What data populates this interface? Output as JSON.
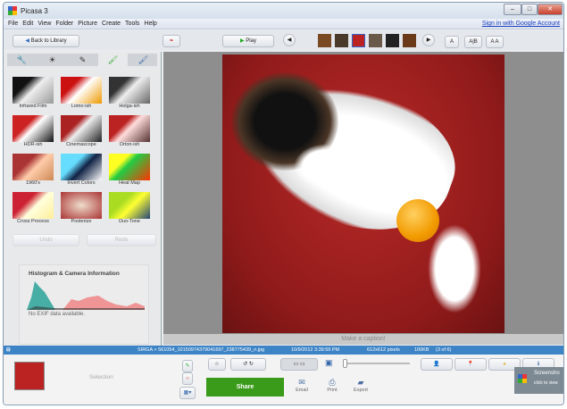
{
  "window": {
    "title": "Picasa 3",
    "controls": [
      "‒",
      "□",
      "✕"
    ]
  },
  "menu": {
    "items": [
      "File",
      "Edit",
      "View",
      "Folder",
      "Picture",
      "Create",
      "Tools",
      "Help"
    ],
    "sign_in": "Sign in with Google Account"
  },
  "toolbar": {
    "back": "Back to Library",
    "play": "Play",
    "layout_buttons": [
      "A",
      "A|B",
      "A A"
    ]
  },
  "left_tabs": [
    "🔧",
    "☀",
    "✎",
    "🖌",
    "🖌"
  ],
  "effects": [
    {
      "label": "Infrared Film",
      "bg": "linear-gradient(135deg,#111 30%,#eee 50%,#999)"
    },
    {
      "label": "Lomo-ish",
      "bg": "linear-gradient(135deg,#c11 30%,#fff 50%,#e90)"
    },
    {
      "label": "Holga-ish",
      "bg": "linear-gradient(135deg,#333 30%,#eee 50%,#666)"
    },
    {
      "label": "HDR-ish",
      "bg": "linear-gradient(135deg,#c22 35%,#fff 50%,#111)"
    },
    {
      "label": "Cinemascope",
      "bg": "linear-gradient(135deg,#a22 35%,#eee 50%,#222)"
    },
    {
      "label": "Orton-ish",
      "bg": "linear-gradient(135deg,#b22 35%,#fdd 50%,#533)"
    },
    {
      "label": "1960's",
      "bg": "linear-gradient(135deg,#a33 35%,#fca 55%,#c85)"
    },
    {
      "label": "Invert Colors",
      "bg": "linear-gradient(135deg,#6df 35%,#124 55%,#fff)"
    },
    {
      "label": "Heat Map",
      "bg": "linear-gradient(135deg,#ff2 30%,#2c4 45%,#f30)"
    },
    {
      "label": "Cross Process",
      "bg": "linear-gradient(135deg,#c23 35%,#ffd 55%,#fe9)"
    },
    {
      "label": "Posterize",
      "bg": "radial-gradient(#edc,#a33)"
    },
    {
      "label": "Duo-Tone",
      "bg": "linear-gradient(135deg,#ad2 35%,#ff3 55%,#247)"
    }
  ],
  "undo": "Undo",
  "redo": "Redo",
  "histogram": {
    "title": "Histogram & Camera Information",
    "note": "No EXIF data available."
  },
  "caption_placeholder": "Make a caption!",
  "status": {
    "path": "SIRGA > 561054_10150974379041697_238775439_n.jpg",
    "date": "10/9/2012 3:39:59 PM",
    "dims": "612x612 pixels",
    "size": "100KB",
    "index": "(3 of 6)"
  },
  "bottom": {
    "selection": "Selection",
    "share": "Share",
    "email": "Email",
    "print": "Print",
    "export": "Export",
    "notification_title": "Screensho",
    "notification_sub": "click to view"
  }
}
